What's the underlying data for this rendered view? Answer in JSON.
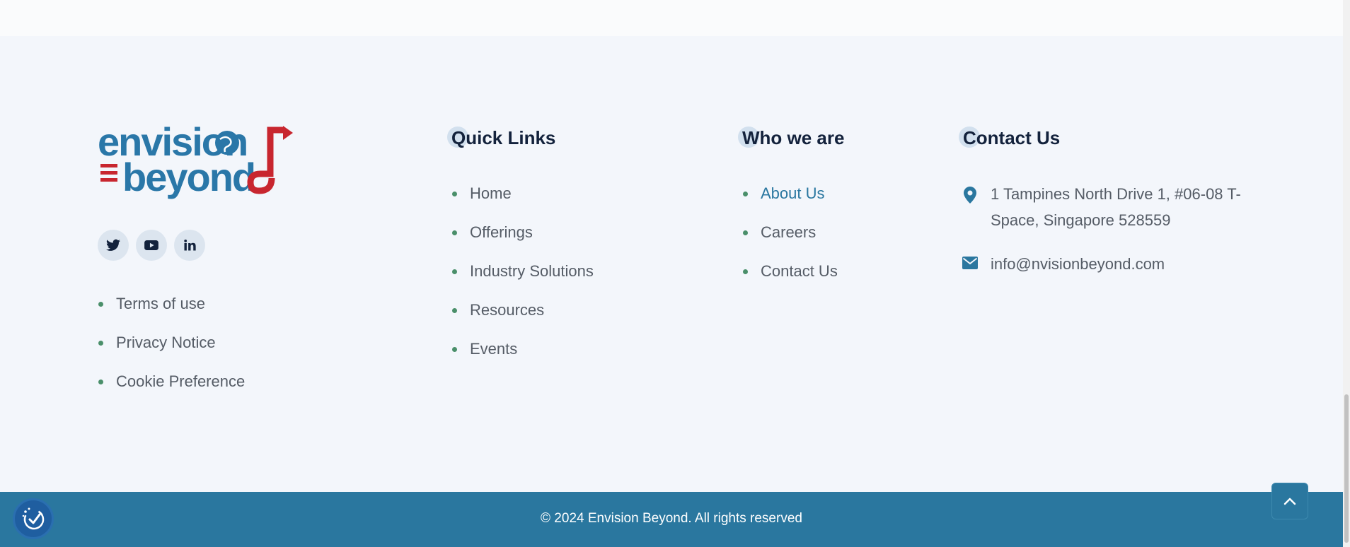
{
  "brand": {
    "logo_alt": "envision beyond",
    "logo_line1": "envision",
    "logo_line2": "beyond"
  },
  "social": [
    {
      "icon": "twitter-icon"
    },
    {
      "icon": "youtube-icon"
    },
    {
      "icon": "linkedin-icon"
    }
  ],
  "legal_links": [
    "Terms of use",
    "Privacy Notice",
    "Cookie Preference"
  ],
  "quick_links": {
    "title": "Quick Links",
    "items": [
      "Home",
      "Offerings",
      "Industry Solutions",
      "Resources",
      "Events"
    ]
  },
  "who_we_are": {
    "title": "Who we are",
    "items": [
      "About Us",
      "Careers",
      "Contact Us"
    ],
    "active": "About Us"
  },
  "contact": {
    "title": "Contact Us",
    "address": "1 Tampines North Drive 1, #06-08 T-Space, Singapore 528559",
    "email": "info@nvisionbeyond.com"
  },
  "footer": {
    "copyright": "© 2024 Envision Beyond. All rights reserved"
  },
  "colors": {
    "accent": "#2a779f",
    "heading": "#13223c",
    "bullet": "#4a8f6a",
    "logo_blue": "#2a77a8",
    "logo_red": "#c8262f"
  }
}
